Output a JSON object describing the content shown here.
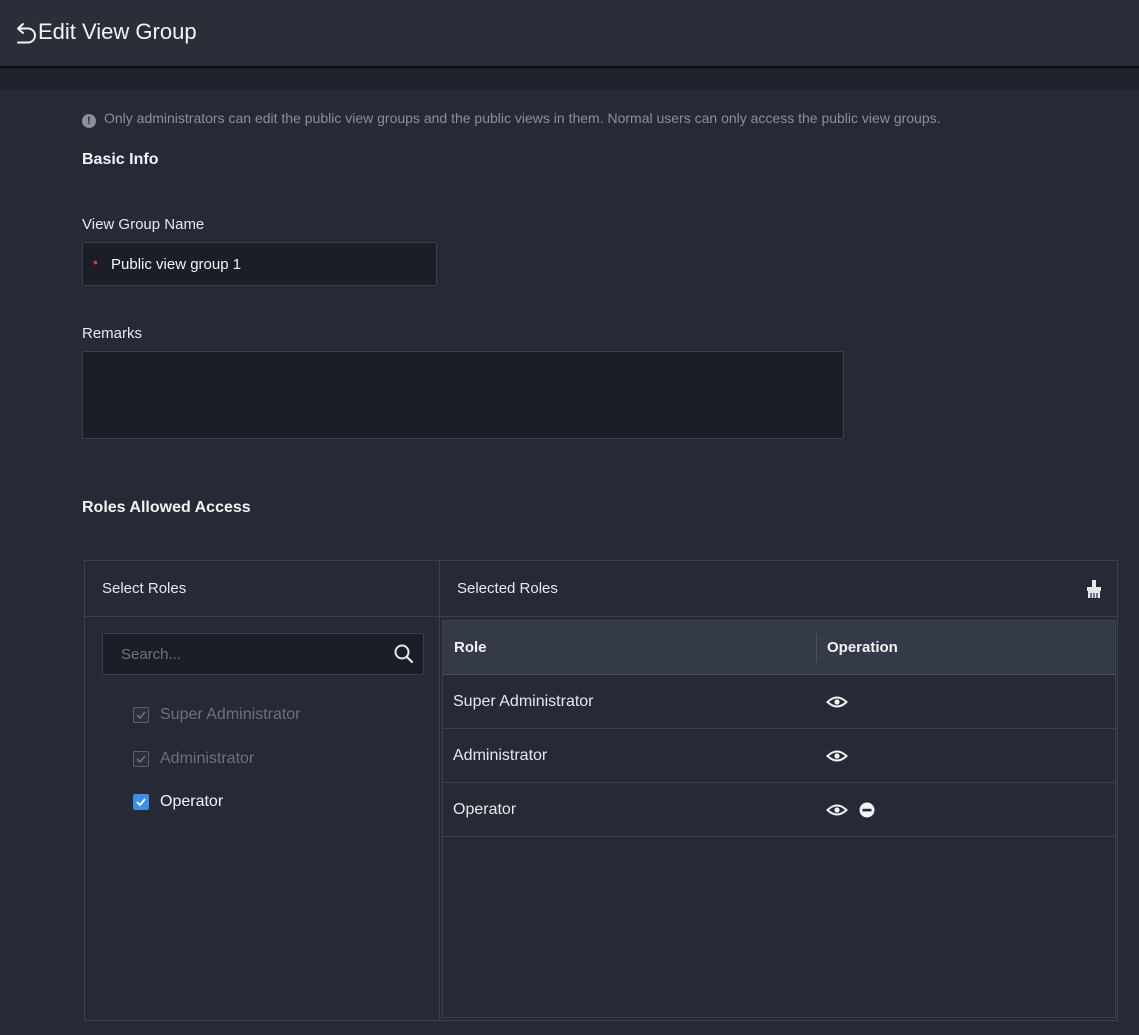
{
  "header": {
    "title": "Edit View Group"
  },
  "notice": "Only administrators can edit the public view groups and the public views in them. Normal users can only access the public view groups.",
  "basic_info": {
    "title": "Basic Info",
    "name_label": "View Group Name",
    "name_value": "Public view group 1",
    "remarks_label": "Remarks",
    "remarks_value": ""
  },
  "roles": {
    "title": "Roles Allowed Access",
    "select_panel": {
      "title": "Select Roles",
      "search_placeholder": "Search...",
      "items": [
        {
          "label": "Super Administrator",
          "checked": true,
          "disabled": true
        },
        {
          "label": "Administrator",
          "checked": true,
          "disabled": true
        },
        {
          "label": "Operator",
          "checked": true,
          "disabled": false
        }
      ]
    },
    "selected_panel": {
      "title": "Selected Roles",
      "columns": [
        "Role",
        "Operation"
      ],
      "rows": [
        {
          "role": "Super Administrator",
          "operations": [
            "view-icon"
          ]
        },
        {
          "role": "Administrator",
          "operations": [
            "view-icon"
          ]
        },
        {
          "role": "Operator",
          "operations": [
            "view-icon",
            "remove-icon"
          ]
        }
      ]
    }
  }
}
